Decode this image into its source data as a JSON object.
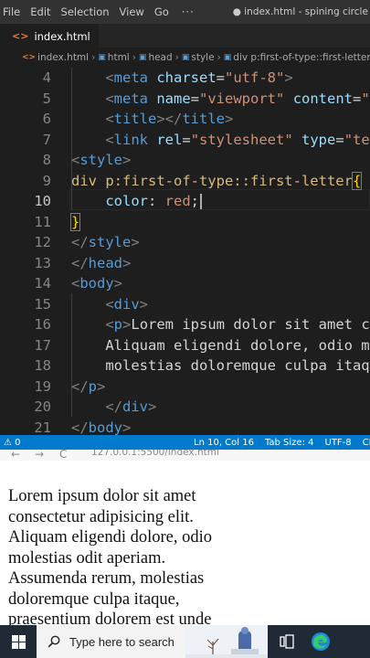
{
  "menubar": {
    "items": [
      "File",
      "Edit",
      "Selection",
      "View",
      "Go"
    ],
    "overflow": "···",
    "window_title": "● index.html - spining circle - Vis..."
  },
  "tab": {
    "icon": "<>",
    "label": "index.html"
  },
  "breadcrumb": {
    "items": [
      "index.html",
      "html",
      "head",
      "style",
      "div p:first-of-type::first-letter"
    ]
  },
  "editor": {
    "active_line": 10,
    "lines": [
      {
        "n": "4",
        "tokens": [
          [
            "punc",
            "    <"
          ],
          [
            "tag",
            "meta"
          ],
          [
            "text",
            " "
          ],
          [
            "attr",
            "charset"
          ],
          [
            "text",
            "="
          ],
          [
            "str",
            "\"utf-8\""
          ],
          [
            "punc",
            ">"
          ]
        ]
      },
      {
        "n": "5",
        "tokens": [
          [
            "punc",
            "    <"
          ],
          [
            "tag",
            "meta"
          ],
          [
            "text",
            " "
          ],
          [
            "attr",
            "name"
          ],
          [
            "text",
            "="
          ],
          [
            "str",
            "\"viewport\""
          ],
          [
            "text",
            " "
          ],
          [
            "attr",
            "content"
          ],
          [
            "text",
            "="
          ],
          [
            "str",
            "\"w"
          ]
        ]
      },
      {
        "n": "6",
        "tokens": [
          [
            "punc",
            "    <"
          ],
          [
            "tag",
            "title"
          ],
          [
            "punc",
            "></"
          ],
          [
            "tag",
            "title"
          ],
          [
            "punc",
            ">"
          ]
        ]
      },
      {
        "n": "7",
        "tokens": [
          [
            "punc",
            "    <"
          ],
          [
            "tag",
            "link"
          ],
          [
            "text",
            " "
          ],
          [
            "attr",
            "rel"
          ],
          [
            "text",
            "="
          ],
          [
            "str",
            "\"stylesheet\""
          ],
          [
            "text",
            " "
          ],
          [
            "attr",
            "type"
          ],
          [
            "text",
            "="
          ],
          [
            "str",
            "\"tex"
          ]
        ]
      },
      {
        "n": "8",
        "tokens": [
          [
            "punc",
            "<"
          ],
          [
            "tag",
            "style"
          ],
          [
            "punc",
            ">"
          ]
        ]
      },
      {
        "n": "9",
        "tokens": [
          [
            "sel",
            "div p:first-of-type::first-letter"
          ],
          [
            "bracem",
            "{"
          ]
        ]
      },
      {
        "n": "10",
        "tokens": [
          [
            "text",
            "    "
          ],
          [
            "prop",
            "color"
          ],
          [
            "text",
            ": "
          ],
          [
            "val",
            "red"
          ],
          [
            "text",
            ";"
          ]
        ],
        "cursor": true
      },
      {
        "n": "11",
        "tokens": [
          [
            "bracem",
            "}"
          ]
        ]
      },
      {
        "n": "12",
        "tokens": [
          [
            "punc",
            "</"
          ],
          [
            "tag",
            "style"
          ],
          [
            "punc",
            ">"
          ]
        ]
      },
      {
        "n": "13",
        "tokens": [
          [
            "punc",
            "</"
          ],
          [
            "tag",
            "head"
          ],
          [
            "punc",
            ">"
          ]
        ]
      },
      {
        "n": "14",
        "tokens": [
          [
            "punc",
            "<"
          ],
          [
            "tag",
            "body"
          ],
          [
            "punc",
            ">"
          ]
        ]
      },
      {
        "n": "15",
        "tokens": [
          [
            "punc",
            "    <"
          ],
          [
            "tag",
            "div"
          ],
          [
            "punc",
            ">"
          ]
        ]
      },
      {
        "n": "16",
        "tokens": [
          [
            "punc",
            "    <"
          ],
          [
            "tag",
            "p"
          ],
          [
            "punc",
            ">"
          ],
          [
            "text",
            "Lorem ipsum dolor sit amet co"
          ]
        ]
      },
      {
        "n": "17",
        "tokens": [
          [
            "text",
            "    Aliquam eligendi dolore, odio mo"
          ]
        ]
      },
      {
        "n": "18",
        "tokens": [
          [
            "text",
            "    molestias doloremque culpa itaqu"
          ]
        ]
      },
      {
        "n": "19",
        "tokens": [
          [
            "punc",
            "</"
          ],
          [
            "tag",
            "p"
          ],
          [
            "punc",
            ">"
          ]
        ]
      },
      {
        "n": "20",
        "tokens": [
          [
            "punc",
            "    </"
          ],
          [
            "tag",
            "div"
          ],
          [
            "punc",
            ">"
          ]
        ]
      },
      {
        "n": "21",
        "tokens": [
          [
            "punc",
            "</"
          ],
          [
            "tag",
            "body"
          ],
          [
            "punc",
            ">"
          ]
        ]
      }
    ]
  },
  "statusbar": {
    "problems": "⚠ 0",
    "position": "Ln 10, Col 16",
    "tab_size": "Tab Size: 4",
    "encoding": "UTF-8",
    "eol": "CRLF"
  },
  "browser": {
    "url": "127.0.0.1:5500/index.html",
    "back": "←",
    "forward": "→",
    "reload": "C",
    "page_text": "Lorem ipsum dolor sit amet consectetur adipisicing elit. Aliquam eligendi dolore, odio molestias odit aperiam. Assumenda rerum, molestias doloremque culpa itaque, praesentium dolorem est unde"
  },
  "taskbar": {
    "search_placeholder": "Type here to search"
  },
  "colors": {
    "accent": "#007acc",
    "editor_bg": "#1e1e1e",
    "taskbar_bg": "#1f2a36"
  }
}
